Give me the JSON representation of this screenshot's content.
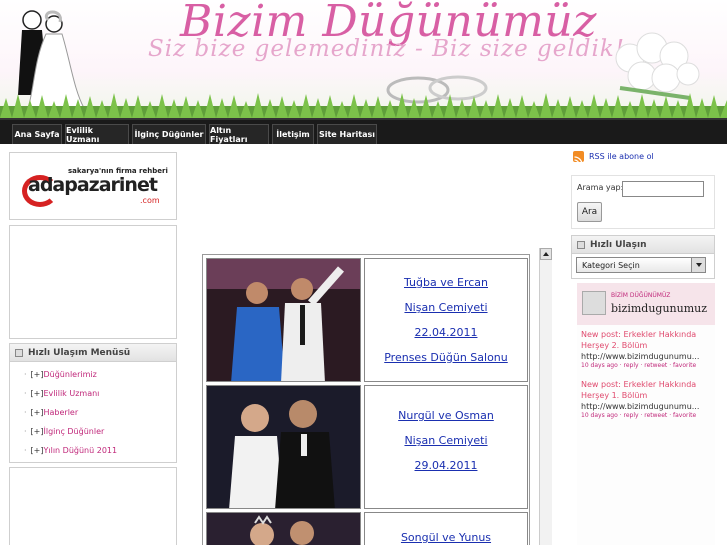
{
  "header": {
    "title": "Bizim Düğünümüz",
    "subtitle": "Siz bize gelemediniz - Biz size geldik!"
  },
  "nav": {
    "items": [
      {
        "label": "Ana Sayfa"
      },
      {
        "label": "Evlilik Uzmanı"
      },
      {
        "label": "İlginç Düğünler"
      },
      {
        "label": "Altın Fiyatları"
      },
      {
        "label": "İletişim"
      },
      {
        "label": "Site Haritası"
      }
    ]
  },
  "left": {
    "ad": {
      "tagline": "sakarya'nın firma rehberi",
      "brand": "adapazarinet",
      "tld": ".com"
    },
    "menu": {
      "title": "Hızlı Ulaşım Menüsü",
      "items": [
        {
          "label": "Düğünlerimiz"
        },
        {
          "label": "Evlilik Uzmanı"
        },
        {
          "label": "Haberler"
        },
        {
          "label": "İlginç Düğünler"
        },
        {
          "label": "Yılın Düğünü 2011"
        }
      ]
    }
  },
  "weddings": [
    {
      "couple": "Tuğba ve Ercan",
      "event": "Nişan Cemiyeti",
      "date": "22.04.2011",
      "venue": "Prenses Düğün Salonu"
    },
    {
      "couple": "Nurgül ve Osman",
      "event": "Nişan Cemiyeti",
      "date": "29.04.2011"
    },
    {
      "couple": "Songül ve Yunus"
    }
  ],
  "right": {
    "rss_label": "RSS ile abone ol",
    "search_label": "Arama yap:",
    "search_button": "Ara",
    "quick_title": "Hızlı Ulaşın",
    "category_select": "Kategori Seçin",
    "twitter": {
      "small_title": "BİZİM DÜĞÜNÜMÜZ",
      "handle": "bizimdugunumuz",
      "posts": [
        {
          "text": "New post: Erkekler Hakkında Herşey 2. Bölüm",
          "url": "http://www.bizimdugunumu...",
          "meta": "10 days ago · reply · retweet · favorite"
        },
        {
          "text": "New post: Erkekler Hakkında Herşey 1. Bölüm",
          "url": "http://www.bizimdugunumu...",
          "meta": "10 days ago · reply · retweet · favorite"
        }
      ]
    }
  },
  "colors": {
    "title_pink": "#d85fa4",
    "link_blue": "#1a2fb0",
    "nav_bg": "#1a1a1a"
  }
}
